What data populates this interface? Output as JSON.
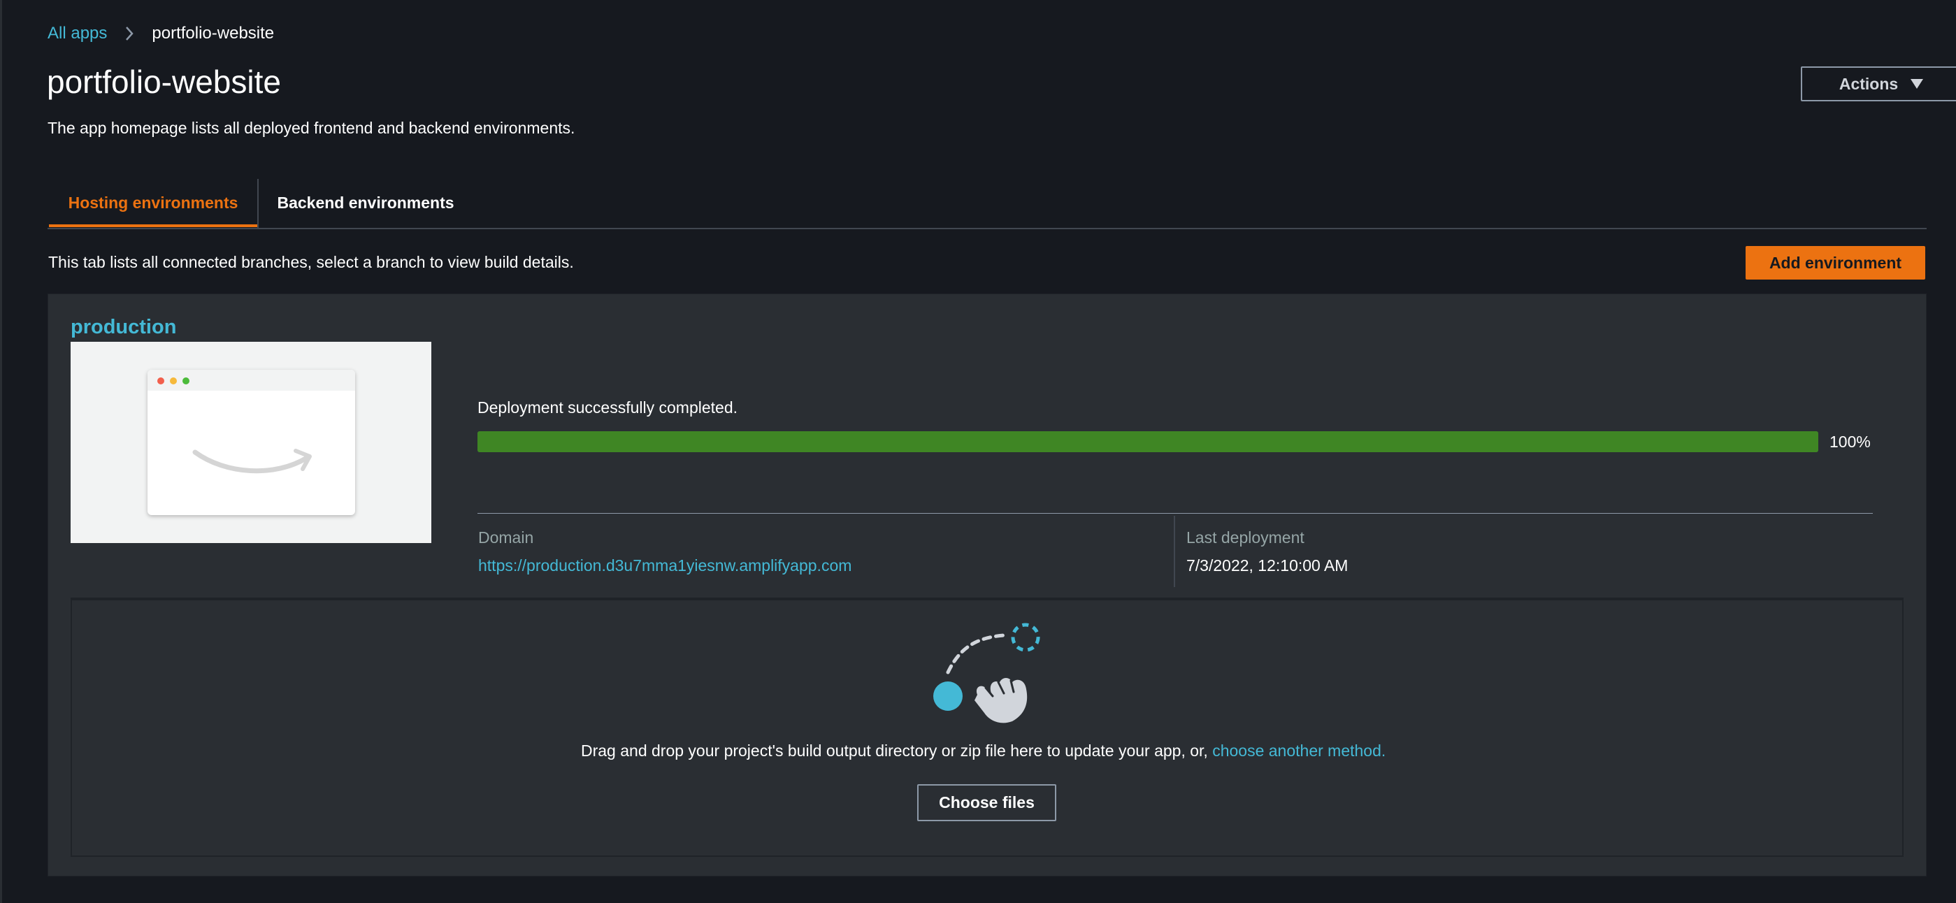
{
  "breadcrumb": {
    "root_label": "All apps",
    "current_label": "portfolio-website"
  },
  "header": {
    "title": "portfolio-website",
    "description": "The app homepage lists all deployed frontend and backend environments.",
    "actions_label": "Actions"
  },
  "tabs": [
    {
      "label": "Hosting environments",
      "active": true
    },
    {
      "label": "Backend environments",
      "active": false
    }
  ],
  "hosting": {
    "helper_text": "This tab lists all connected branches, select a branch to view build details.",
    "add_environment_label": "Add environment"
  },
  "branch": {
    "name": "production",
    "status_text": "Deployment successfully completed.",
    "progress": 100,
    "progress_label": "100%",
    "domain_label": "Domain",
    "domain_url": "https://production.d3u7mma1yiesnw.amplifyapp.com",
    "last_deployment_label": "Last deployment",
    "last_deployment_value": "7/3/2022, 12:10:00 AM"
  },
  "dropzone": {
    "text": "Drag and drop your project's build output directory or zip file here to update your app, or, ",
    "link_text": "choose another method.",
    "choose_files_label": "Choose files",
    "icon": "drag-drop-hand-icon"
  },
  "colors": {
    "background": "#16191f",
    "card": "#2a2e33",
    "accent": "#ec7211",
    "link": "#44b9d6",
    "success": "#3f8624"
  }
}
